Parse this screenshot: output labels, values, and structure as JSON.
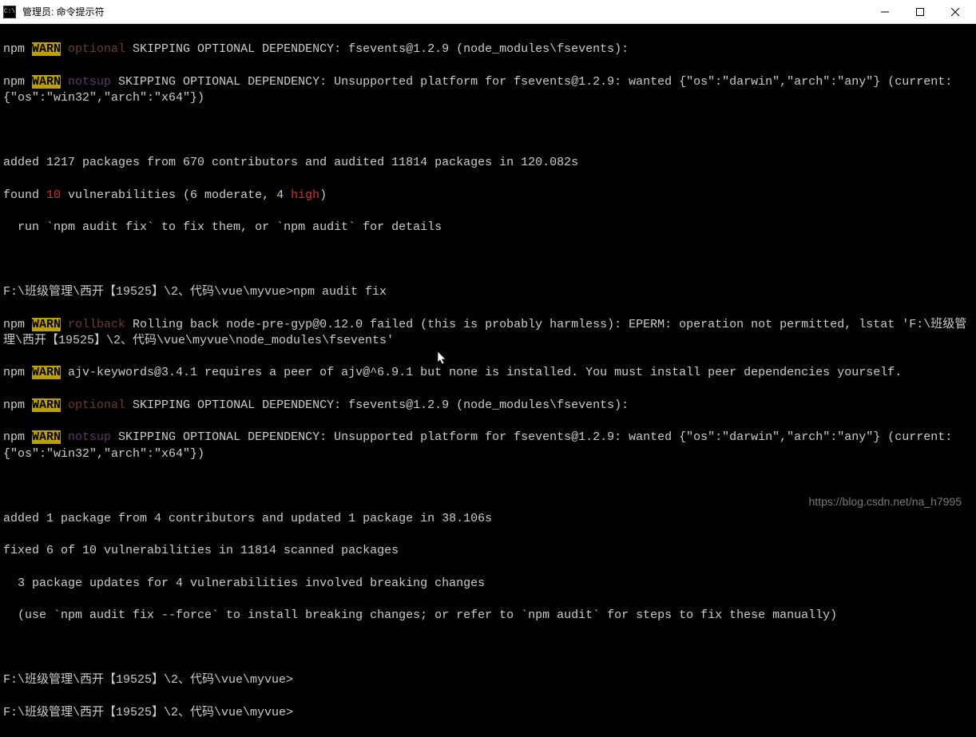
{
  "titlebar": {
    "icon_label": "C:\\",
    "title": "管理员: 命令提示符"
  },
  "terminal": {
    "l1_npm": "npm ",
    "l1_warn": "WARN",
    "l1_opt": " optional",
    "l1_rest": " SKIPPING OPTIONAL DEPENDENCY: fsevents@1.2.9 (node_modules\\fsevents):",
    "l2_npm": "npm ",
    "l2_warn": "WARN",
    "l2_notsup": " notsup",
    "l2_rest": " SKIPPING OPTIONAL DEPENDENCY: Unsupported platform for fsevents@1.2.9: wanted {\"os\":\"darwin\",\"arch\":\"any\"} (current: {\"os\":\"win32\",\"arch\":\"x64\"})",
    "l3": "added 1217 packages from 670 contributors and audited 11814 packages in 120.082s",
    "l4_a": "found ",
    "l4_num": "10",
    "l4_b": " vulnerabilities (6 moderate, 4 ",
    "l4_high": "high",
    "l4_c": ")",
    "l5": "  run `npm audit fix` to fix them, or `npm audit` for details",
    "l6": "F:\\班级管理\\西开【19525】\\2、代码\\vue\\myvue>npm audit fix",
    "l7_npm": "npm ",
    "l7_warn": "WARN",
    "l7_roll": " rollback",
    "l7_rest": " Rolling back node-pre-gyp@0.12.0 failed (this is probably harmless): EPERM: operation not permitted, lstat 'F:\\班级管理\\西开【19525】\\2、代码\\vue\\myvue\\node_modules\\fsevents'",
    "l8_npm": "npm ",
    "l8_warn": "WARN",
    "l8_rest": " ajv-keywords@3.4.1 requires a peer of ajv@^6.9.1 but none is installed. You must install peer dependencies yourself.",
    "l9_npm": "npm ",
    "l9_warn": "WARN",
    "l9_opt": " optional",
    "l9_rest": " SKIPPING OPTIONAL DEPENDENCY: fsevents@1.2.9 (node_modules\\fsevents):",
    "l10_npm": "npm ",
    "l10_warn": "WARN",
    "l10_notsup": " notsup",
    "l10_rest": " SKIPPING OPTIONAL DEPENDENCY: Unsupported platform for fsevents@1.2.9: wanted {\"os\":\"darwin\",\"arch\":\"any\"} (current: {\"os\":\"win32\",\"arch\":\"x64\"})",
    "l11": "added 1 package from 4 contributors and updated 1 package in 38.106s",
    "l12": "fixed 6 of 10 vulnerabilities in 11814 scanned packages",
    "l13": "  3 package updates for 4 vulnerabilities involved breaking changes",
    "l14": "  (use `npm audit fix --force` to install breaking changes; or refer to `npm audit` for steps to fix these manually)",
    "l15": "F:\\班级管理\\西开【19525】\\2、代码\\vue\\myvue>",
    "l16": "F:\\班级管理\\西开【19525】\\2、代码\\vue\\myvue>"
  },
  "watermark": "https://blog.csdn.net/na_h7995"
}
